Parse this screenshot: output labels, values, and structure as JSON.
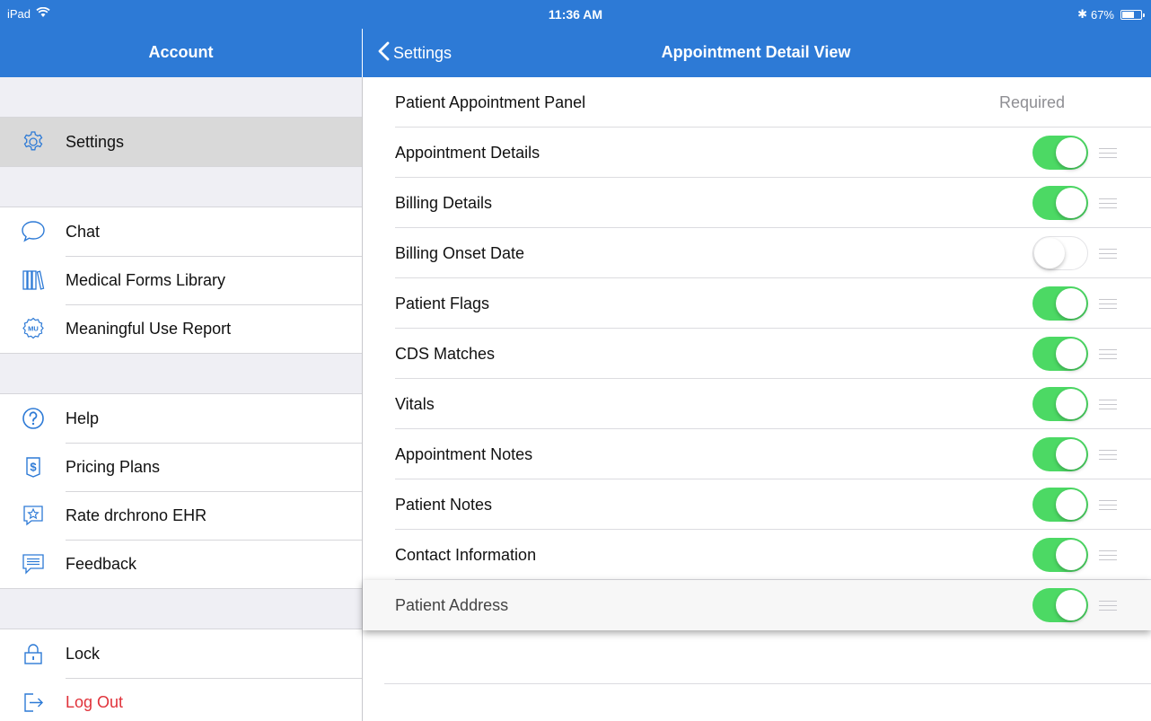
{
  "status_bar": {
    "device": "iPad",
    "time": "11:36 AM",
    "bluetooth": "✱",
    "battery_percent": "67%",
    "battery_level": 0.67,
    "wifi_icon": "wifi-icon"
  },
  "colors": {
    "accent": "#2d7ad6",
    "toggle_on": "#4cd964",
    "danger": "#e0323a",
    "sidebar_bg": "#efeff4"
  },
  "left_nav": {
    "title": "Account"
  },
  "right_nav": {
    "back_label": "Settings",
    "title": "Appointment Detail View"
  },
  "sidebar": {
    "settings": {
      "label": "Settings",
      "icon": "gear-icon",
      "selected": true
    },
    "chat": {
      "label": "Chat",
      "icon": "chat-bubble-icon"
    },
    "forms": {
      "label": "Medical Forms Library",
      "icon": "books-icon"
    },
    "mu": {
      "label": "Meaningful Use Report",
      "icon": "mu-badge-icon",
      "badge_text": "MU"
    },
    "help": {
      "label": "Help",
      "icon": "question-icon"
    },
    "pricing": {
      "label": "Pricing Plans",
      "icon": "dollar-icon"
    },
    "rate": {
      "label": "Rate drchrono EHR",
      "icon": "star-icon"
    },
    "feedback": {
      "label": "Feedback",
      "icon": "feedback-icon"
    },
    "lock": {
      "label": "Lock",
      "icon": "lock-icon"
    },
    "logout": {
      "label": "Log Out",
      "icon": "logout-icon"
    }
  },
  "panel": {
    "required_row": {
      "label": "Patient Appointment Panel",
      "status": "Required"
    },
    "rows": [
      {
        "label": "Appointment Details",
        "enabled": true
      },
      {
        "label": "Billing Details",
        "enabled": true
      },
      {
        "label": "Billing Onset Date",
        "enabled": false
      },
      {
        "label": "Patient Flags",
        "enabled": true
      },
      {
        "label": "CDS Matches",
        "enabled": true
      },
      {
        "label": "Vitals",
        "enabled": true
      },
      {
        "label": "Appointment Notes",
        "enabled": true
      },
      {
        "label": "Patient Notes",
        "enabled": true
      },
      {
        "label": "Contact Information",
        "enabled": true
      },
      {
        "label": "Patient Address",
        "enabled": true,
        "dragging": true
      }
    ]
  }
}
